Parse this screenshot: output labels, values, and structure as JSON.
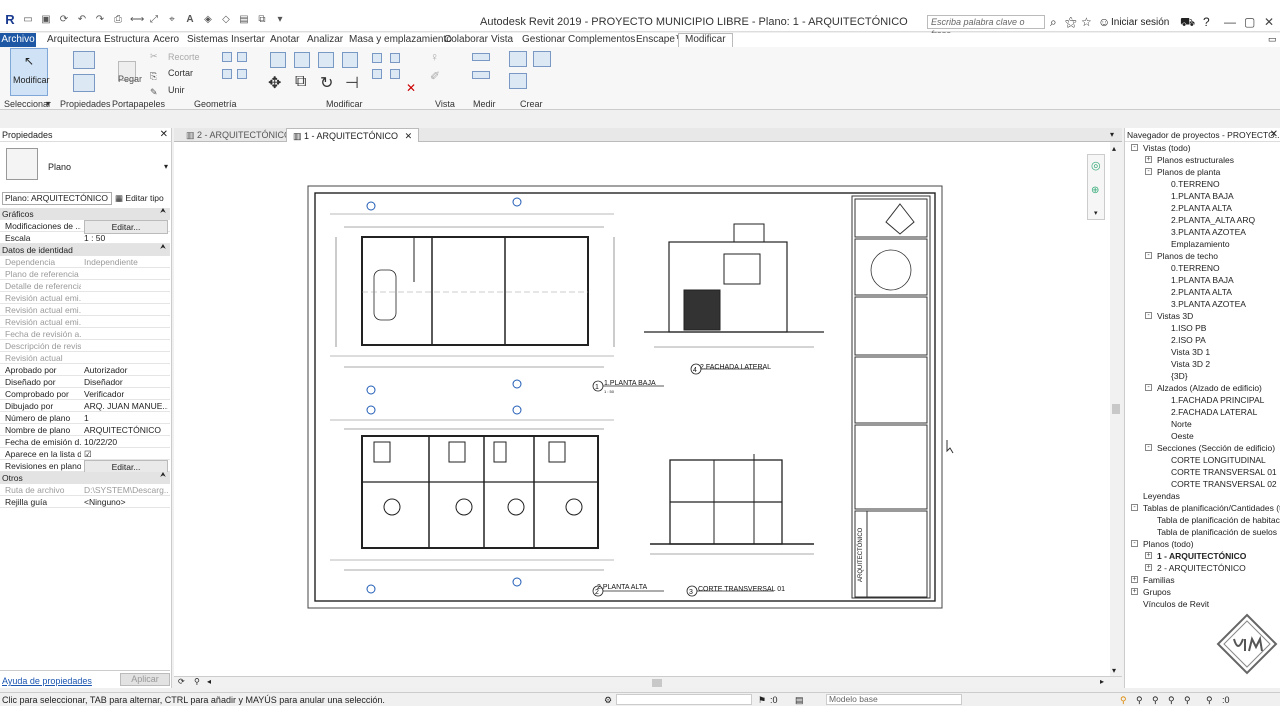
{
  "app": {
    "title": "Autodesk Revit 2019 - PROYECTO MUNICIPIO LIBRE - Plano: 1 - ARQUITECTÓNICO",
    "search_placeholder": "Escriba palabra clave o frase",
    "signin": "Iniciar sesión"
  },
  "menu": {
    "archivo": "Archivo",
    "tabs": [
      "Arquitectura",
      "Estructura",
      "Acero",
      "Sistemas",
      "Insertar",
      "Anotar",
      "Analizar",
      "Masa y emplazamiento",
      "Colaborar",
      "Vista",
      "Gestionar",
      "Complementos",
      "Enscape™",
      "Modificar"
    ]
  },
  "ribbon": {
    "modificar": "Modificar",
    "recorte": "Recorte",
    "pegar": "Pegar",
    "cortar": "Cortar",
    "unir": "Unir",
    "groups": {
      "seleccionar": "Seleccionar",
      "propiedades": "Propiedades",
      "portapapeles": "Portapapeles",
      "geometria": "Geometría",
      "modificar": "Modificar",
      "vista": "Vista",
      "medir": "Medir",
      "crear": "Crear"
    }
  },
  "properties": {
    "title": "Propiedades",
    "type": "Plano",
    "selector": "Plano: ARQUITECTÓNICO",
    "edit_type": "Editar tipo",
    "sec_graficos": "Gráficos",
    "sec_identidad": "Datos de identidad",
    "sec_otros": "Otros",
    "rows_graficos": [
      {
        "k": "Modificaciones de ...",
        "v": "Editar..."
      },
      {
        "k": "Escala",
        "v": "1 : 50"
      }
    ],
    "rows_identidad": [
      {
        "k": "Dependencia",
        "v": "Independiente"
      },
      {
        "k": "Plano de referencia",
        "v": ""
      },
      {
        "k": "Detalle de referencia",
        "v": ""
      },
      {
        "k": "Revisión actual emi...",
        "v": ""
      },
      {
        "k": "Revisión actual emi...",
        "v": ""
      },
      {
        "k": "Revisión actual emi...",
        "v": ""
      },
      {
        "k": "Fecha de revisión a...",
        "v": ""
      },
      {
        "k": "Descripción de revis...",
        "v": ""
      },
      {
        "k": "Revisión actual",
        "v": ""
      },
      {
        "k": "Aprobado por",
        "v": "Autorizador"
      },
      {
        "k": "Diseñado por",
        "v": "Diseñador"
      },
      {
        "k": "Comprobado por",
        "v": "Verificador"
      },
      {
        "k": "Dibujado por",
        "v": "ARQ. JUAN MANUE..."
      },
      {
        "k": "Número de plano",
        "v": "1"
      },
      {
        "k": "Nombre de plano",
        "v": "ARQUITECTÓNICO"
      },
      {
        "k": "Fecha de emisión d...",
        "v": "10/22/20"
      },
      {
        "k": "Aparece en la lista d...",
        "v": "☑"
      },
      {
        "k": "Revisiones en plano",
        "v": "Editar..."
      }
    ],
    "rows_otros": [
      {
        "k": "Ruta de archivo",
        "v": "D:\\SYSTEM\\Descarg..."
      },
      {
        "k": "Rejilla guía",
        "v": "<Ninguno>"
      }
    ],
    "help": "Ayuda de propiedades",
    "apply": "Aplicar"
  },
  "views": {
    "tab1": "2 - ARQUITECTÓNICO",
    "tab2": "1 - ARQUITECTÓNICO"
  },
  "sheet": {
    "l1": "1.PLANTA BAJA",
    "l2": "2.PLANTA ALTA",
    "l3": "2.FACHADA LATERAL",
    "l4": "CORTE TRANSVERSAL 01",
    "n1": "1",
    "n2": "2",
    "n3": "4",
    "n4": "3",
    "scale": "1 : 50",
    "vertical": "ARQUITECTÓNICO"
  },
  "browser": {
    "title": "Navegador de proyectos - PROYECTO...",
    "items": [
      {
        "t": "Vistas (todo)",
        "l": 0,
        "tog": "-"
      },
      {
        "t": "Planos estructurales",
        "l": 1,
        "tog": "+"
      },
      {
        "t": "Planos de planta",
        "l": 1,
        "tog": "-"
      },
      {
        "t": "0.TERRENO",
        "l": 2
      },
      {
        "t": "1.PLANTA BAJA",
        "l": 2
      },
      {
        "t": "2.PLANTA ALTA",
        "l": 2
      },
      {
        "t": "2.PLANTA_ALTA ARQ",
        "l": 2
      },
      {
        "t": "3.PLANTA AZOTEA",
        "l": 2
      },
      {
        "t": "Emplazamiento",
        "l": 2
      },
      {
        "t": "Planos de techo",
        "l": 1,
        "tog": "-"
      },
      {
        "t": "0.TERRENO",
        "l": 2
      },
      {
        "t": "1.PLANTA BAJA",
        "l": 2
      },
      {
        "t": "2.PLANTA ALTA",
        "l": 2
      },
      {
        "t": "3.PLANTA AZOTEA",
        "l": 2
      },
      {
        "t": "Vistas 3D",
        "l": 1,
        "tog": "-"
      },
      {
        "t": "1.ISO PB",
        "l": 2
      },
      {
        "t": "2.ISO PA",
        "l": 2
      },
      {
        "t": "Vista 3D 1",
        "l": 2
      },
      {
        "t": "Vista 3D 2",
        "l": 2
      },
      {
        "t": "{3D}",
        "l": 2
      },
      {
        "t": "Alzados (Alzado de edificio)",
        "l": 1,
        "tog": "-"
      },
      {
        "t": "1.FACHADA PRINCIPAL",
        "l": 2
      },
      {
        "t": "2.FACHADA LATERAL",
        "l": 2
      },
      {
        "t": "Norte",
        "l": 2
      },
      {
        "t": "Oeste",
        "l": 2
      },
      {
        "t": "Secciones (Sección de edificio)",
        "l": 1,
        "tog": "-"
      },
      {
        "t": "CORTE LONGITUDINAL",
        "l": 2
      },
      {
        "t": "CORTE TRANSVERSAL 01",
        "l": 2
      },
      {
        "t": "CORTE TRANSVERSAL 02",
        "l": 2
      },
      {
        "t": "Leyendas",
        "l": 0
      },
      {
        "t": "Tablas de planificación/Cantidades (t",
        "l": 0,
        "tog": "-"
      },
      {
        "t": "Tabla de planificación de habitacior",
        "l": 1
      },
      {
        "t": "Tabla de planificación de suelos",
        "l": 1
      },
      {
        "t": "Planos (todo)",
        "l": 0,
        "tog": "-"
      },
      {
        "t": "1 - ARQUITECTÓNICO",
        "l": 1,
        "tog": "+",
        "bold": true
      },
      {
        "t": "2 - ARQUITECTÓNICO",
        "l": 1,
        "tog": "+"
      },
      {
        "t": "Familias",
        "l": 0,
        "tog": "+"
      },
      {
        "t": "Grupos",
        "l": 0,
        "tog": "+"
      },
      {
        "t": "Vínculos de Revit",
        "l": 0
      }
    ]
  },
  "status": {
    "text": "Clic para seleccionar, TAB para alternar, CTRL para añadir y MAYÚS para anular una selección.",
    "zero": ":0",
    "model": "Modelo base",
    "filter": ":0"
  }
}
